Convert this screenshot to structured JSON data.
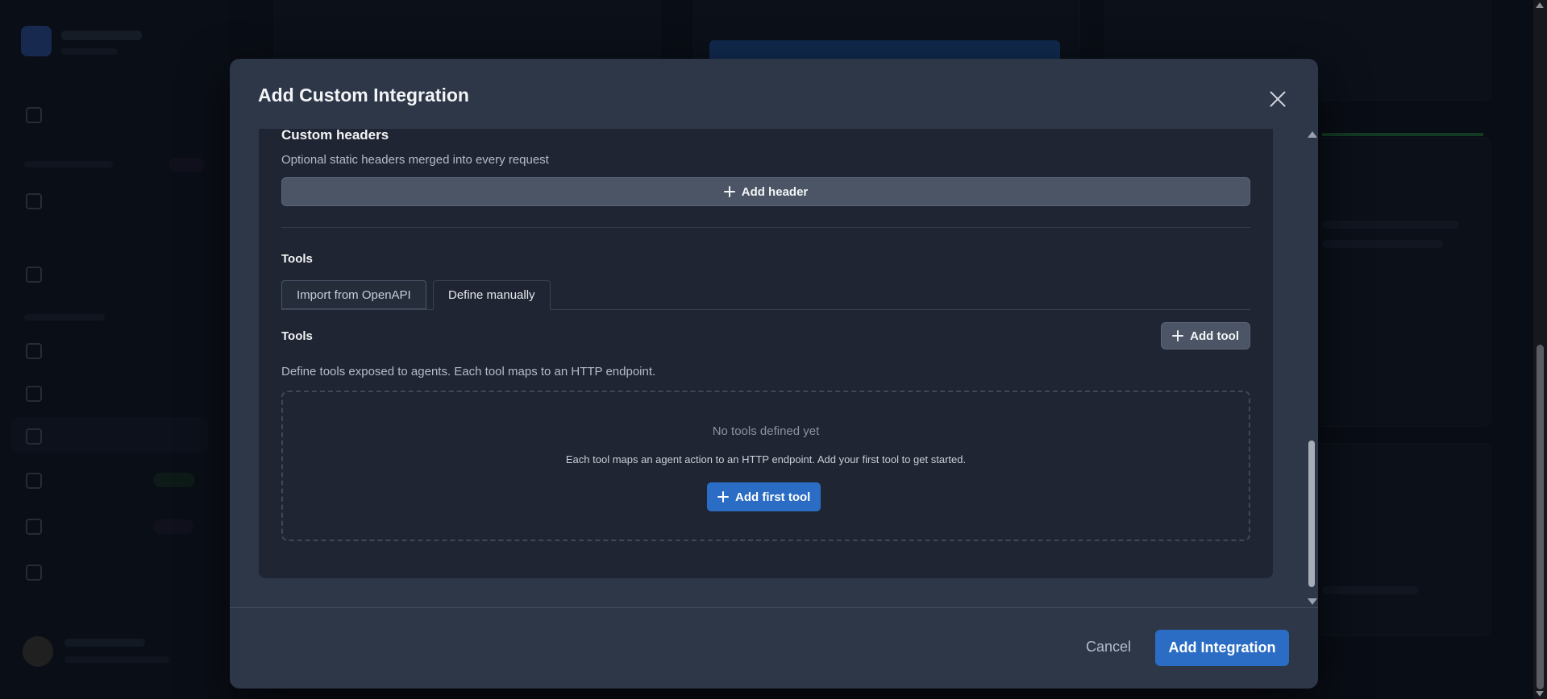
{
  "modal": {
    "title": "Add Custom Integration",
    "close_icon": "close-icon"
  },
  "custom_headers": {
    "title": "Custom headers",
    "description": "Optional static headers merged into every request",
    "add_header_label": "Add header"
  },
  "tools_section": {
    "heading": "Tools",
    "tabs": [
      {
        "label": "Import from OpenAPI",
        "active": false
      },
      {
        "label": "Define manually",
        "active": true
      }
    ],
    "subheading": "Tools",
    "add_tool_label": "Add tool",
    "description": "Define tools exposed to agents. Each tool maps to an HTTP endpoint.",
    "empty_state": {
      "title": "No tools defined yet",
      "description": "Each tool maps an agent action to an HTTP endpoint. Add your first tool to get started.",
      "button_label": "Add first tool"
    }
  },
  "footer": {
    "cancel_label": "Cancel",
    "submit_label": "Add Integration"
  },
  "colors": {
    "modal_bg": "#2d3748",
    "body_bg": "#1f2532",
    "primary": "#2b6cc4",
    "secondary_button": "#4b5565"
  }
}
